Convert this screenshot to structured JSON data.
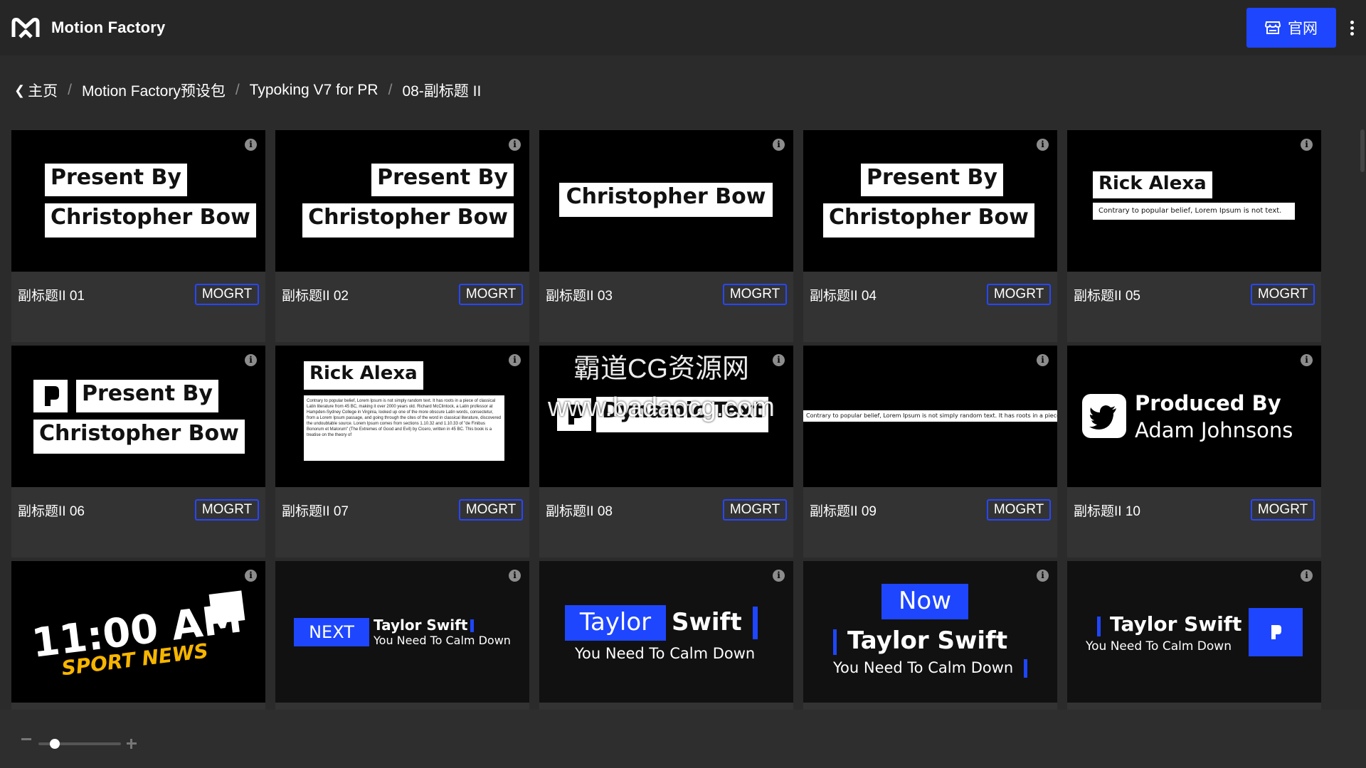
{
  "app": {
    "title": "Motion Factory",
    "site_button": "官网"
  },
  "breadcrumb": {
    "home": "主页",
    "items": [
      "Motion Factory预设包",
      "Typoking V7 for PR",
      "08-副标题 II"
    ]
  },
  "badge_label": "MOGRT",
  "cards": [
    {
      "name": "副标题II 01",
      "thumb": [
        "Present By",
        "Christopher Bow"
      ]
    },
    {
      "name": "副标题II 02",
      "thumb": [
        "Present By",
        "Christopher Bow"
      ]
    },
    {
      "name": "副标题II 03",
      "thumb": [
        "Christopher Bow"
      ]
    },
    {
      "name": "副标题II 04",
      "thumb": [
        "Present By",
        "Christopher Bow"
      ]
    },
    {
      "name": "副标题II 05",
      "thumb": [
        "Rick Alexa",
        "Contrary to popular belief, Lorem Ipsum is not text."
      ]
    },
    {
      "name": "副标题II 06",
      "thumb": [
        "Present By",
        "Christopher Bow"
      ]
    },
    {
      "name": "副标题II 07",
      "thumb": [
        "Rick Alexa",
        "Contrary to popular belief, Lorem Ipsum is not simply random text. It has roots in a piece of classical Latin literature from 45 BC, making it over 2000 years old. Richard McClintock, a Latin professor at Hampden-Sydney College in Virginia, looked up one of the more obscure Latin words, consectetur, from a Lorem Ipsum passage, and going through the cites of the word in classical literature, discovered the undoubtable source. Lorem Ipsum comes from sections 1.10.32 and 1.10.33 of \"de Finibus Bonorum et Malorum\" (The Extremes of Good and Evil) by Cicero, written in 45 BC. This book is a treatise on the theory of"
      ]
    },
    {
      "name": "副标题II 08",
      "thumb": [
        "Dynamic Text"
      ]
    },
    {
      "name": "副标题II 09",
      "thumb": [
        "Contrary to popular belief, Lorem Ipsum is not simply random text. It has roots in a piece of"
      ]
    },
    {
      "name": "副标题II 10",
      "thumb": [
        "Produced By",
        "Adam Johnsons"
      ]
    },
    {
      "name": "",
      "thumb": [
        "11:00 AM",
        "SPORT NEWS"
      ]
    },
    {
      "name": "",
      "thumb": [
        "NEXT",
        "Taylor Swift",
        "You Need To Calm Down"
      ]
    },
    {
      "name": "",
      "thumb": [
        "Taylor",
        "Swift",
        "You Need To Calm Down"
      ]
    },
    {
      "name": "",
      "thumb": [
        "Now",
        "Taylor Swift",
        "You Need To Calm Down"
      ]
    },
    {
      "name": "",
      "thumb": [
        "Taylor Swift",
        "You Need To Calm Down"
      ]
    }
  ],
  "watermark": [
    "霸道CG资源网",
    "www.badaocg.com"
  ],
  "zoom": {
    "value": 0.2
  },
  "colors": {
    "accent": "#1e46ff",
    "background": "#2b2b2b",
    "card": "#333333"
  },
  "icons": [
    "motion-factory-logo-icon",
    "store-icon",
    "kebab-menu-icon",
    "chevron-left-icon",
    "info-icon",
    "twitter-icon",
    "logo-mark-icon"
  ]
}
